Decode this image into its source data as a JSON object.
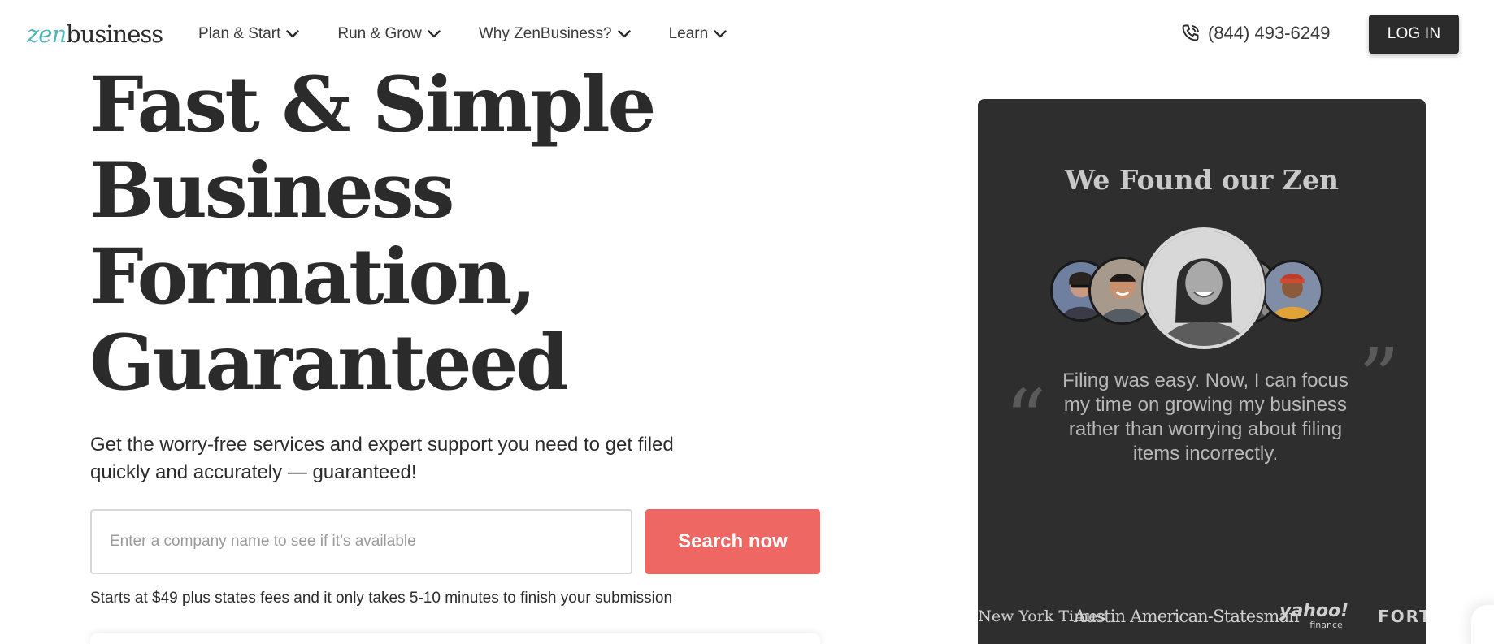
{
  "header": {
    "logo": {
      "part1": "zen",
      "part2": "business"
    },
    "nav": [
      {
        "label": "Plan & Start",
        "icon": "chevron-down-icon"
      },
      {
        "label": "Run & Grow",
        "icon": "chevron-down-icon"
      },
      {
        "label": "Why ZenBusiness?",
        "icon": "chevron-down-icon"
      },
      {
        "label": "Learn",
        "icon": "chevron-down-icon"
      }
    ],
    "phone": {
      "icon": "phone-icon",
      "number": "(844) 493-6249"
    },
    "login_label": "LOG IN"
  },
  "hero": {
    "title_lines": [
      "Fast & Simple",
      "Business",
      "Formation,",
      "Guaranteed"
    ],
    "subtitle": "Get the worry-free services and expert support you need to get filed quickly and accurately — guaranteed!",
    "search": {
      "placeholder": "Enter a company name to see if it’s available",
      "button_label": "Search now"
    },
    "fine_print": "Starts at $49 plus states fees and it only takes 5-10 minutes to finish your submission"
  },
  "testimonial": {
    "title": "We Found our Zen",
    "quote_open": "“",
    "quote_close": "”",
    "quote": "Filing was easy. Now, I can focus my time on growing my business rather than worrying about filing items incorrectly.",
    "press": {
      "nyt": "The New York Times",
      "aas": "Austin American-Statesman",
      "yahoo_main": "yahoo!",
      "yahoo_sub": "finance",
      "fortune": "FORTUNE"
    }
  },
  "colors": {
    "brand_teal": "#4eb7bb",
    "accent_coral": "#ee6762",
    "dark": "#2b2b2b",
    "panel": "#2e2e2e"
  }
}
